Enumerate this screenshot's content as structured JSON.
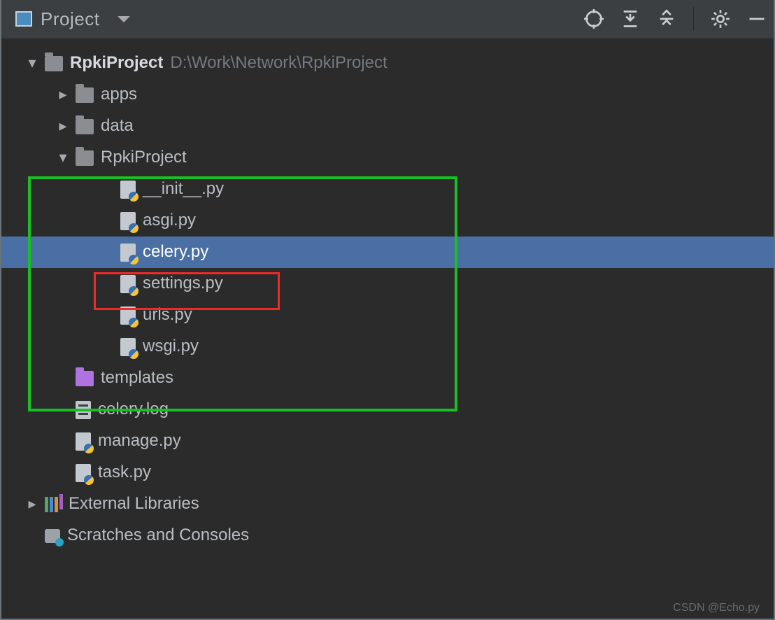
{
  "toolbar": {
    "title": "Project"
  },
  "root": {
    "name": "RpkiProject",
    "path": "D:\\Work\\Network\\RpkiProject"
  },
  "rootChildren": {
    "apps": "apps",
    "data": "data",
    "rpki": "RpkiProject",
    "templates": "templates",
    "celerylog": "celery.log",
    "manage": "manage.py",
    "task": "task.py"
  },
  "rpkiFiles": {
    "init": "__init__.py",
    "asgi": "asgi.py",
    "celery": "celery.py",
    "settings": "settings.py",
    "urls": "urls.py",
    "wsgi": "wsgi.py"
  },
  "extras": {
    "ext": "External Libraries",
    "scratch": "Scratches and Consoles"
  },
  "watermark": "CSDN @Echo.py"
}
